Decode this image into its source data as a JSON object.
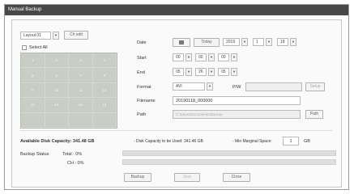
{
  "window": {
    "title": "Manual Backup"
  },
  "layout_panel": {
    "layout_value": "Layout 01",
    "ch_edit_label": "Ch edit",
    "select_all_label": "Select All",
    "channels": [
      "1",
      "2",
      "3",
      "4",
      "5",
      "6",
      "7",
      "8",
      "9",
      "10",
      "11",
      "12",
      "13",
      "14",
      "15",
      "16",
      "",
      "",
      "",
      ""
    ]
  },
  "form": {
    "date_label": "Date",
    "today_label": "Today",
    "year": "2019",
    "month": "1",
    "day": "18",
    "start_label": "Start",
    "start_h": "00",
    "start_m": "00",
    "start_s": "00",
    "end_label": "End",
    "end_h": "05",
    "end_m": "26",
    "end_s": "05",
    "format_label": "Format",
    "format_value": "AVI",
    "pw_label": "P/W",
    "setup_label": "Setup",
    "filename_label": "Filename",
    "filename_value": "20190118_000000",
    "path_label": "Path",
    "path_value": "C:\\Users\\Documents\\Backup",
    "path_button": "Path"
  },
  "capacity": {
    "available_label": "Available Disk Capacity: 341.48 GB",
    "to_be_used_label": "- Disk Capacity to be Used: 341.46 GB",
    "marginal_label": "- Min Marginal Space:",
    "marginal_value": "1",
    "marginal_unit": "GB"
  },
  "status": {
    "label": "Backup Status",
    "total": "Total : 0%",
    "ch": "CH : 0%"
  },
  "buttons": {
    "backup": "Backup",
    "stop": "Stop",
    "close": "Close"
  }
}
